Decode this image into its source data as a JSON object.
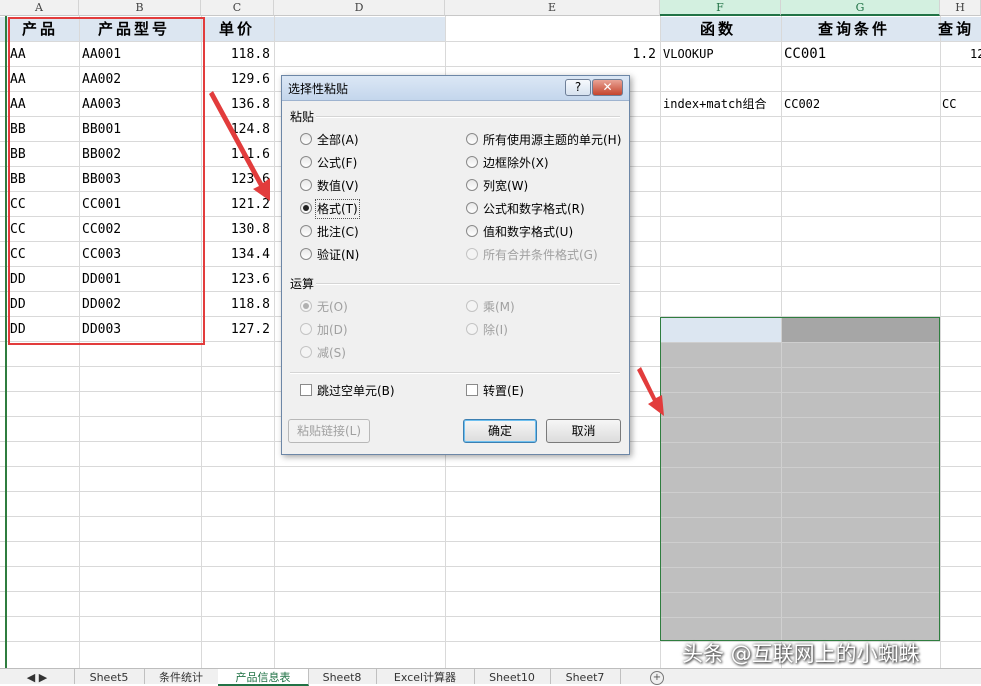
{
  "columns": [
    "A",
    "B",
    "C",
    "D",
    "E",
    "F",
    "G",
    "H"
  ],
  "header_row": {
    "a": "产品",
    "b": "产品型号",
    "c": "单价",
    "f": "函数",
    "g": "查询条件",
    "h": "查询"
  },
  "rows": [
    {
      "a": "AA",
      "b": "AA001",
      "c": "118.8"
    },
    {
      "a": "AA",
      "b": "AA002",
      "c": "129.6"
    },
    {
      "a": "AA",
      "b": "AA003",
      "c": "136.8"
    },
    {
      "a": "BB",
      "b": "BB001",
      "c": "124.8"
    },
    {
      "a": "BB",
      "b": "BB002",
      "c": "111.6"
    },
    {
      "a": "BB",
      "b": "BB003",
      "c": "123.6"
    },
    {
      "a": "CC",
      "b": "CC001",
      "c": "121.2"
    },
    {
      "a": "CC",
      "b": "CC002",
      "c": "130.8"
    },
    {
      "a": "CC",
      "b": "CC003",
      "c": "134.4"
    },
    {
      "a": "DD",
      "b": "DD001",
      "c": "123.6"
    },
    {
      "a": "DD",
      "b": "DD002",
      "c": "118.8"
    },
    {
      "a": "DD",
      "b": "DD003",
      "c": "127.2"
    }
  ],
  "extra": {
    "e2": "1.2",
    "f2": "VLOOKUP",
    "g2": "CC001",
    "h2": "12",
    "f4": "index+match组合",
    "g4": "CC002",
    "h4": "CC"
  },
  "tabs": [
    "Sheet5",
    "条件统计",
    "产品信息表",
    "Sheet8",
    "Excel计算器",
    "Sheet10",
    "Sheet7"
  ],
  "active_tab": "产品信息表",
  "dialog": {
    "title": "选择性粘贴",
    "help": "?",
    "close": "✕",
    "paste_section": "粘贴",
    "paste_left": [
      "全部(A)",
      "公式(F)",
      "数值(V)",
      "格式(T)",
      "批注(C)",
      "验证(N)"
    ],
    "paste_right": [
      "所有使用源主题的单元(H)",
      "边框除外(X)",
      "列宽(W)",
      "公式和数字格式(R)",
      "值和数字格式(U)",
      "所有合并条件格式(G)"
    ],
    "operation_section": "运算",
    "op_left": [
      "无(O)",
      "加(D)",
      "减(S)"
    ],
    "op_right": [
      "乘(M)",
      "除(I)"
    ],
    "skip_blanks": "跳过空单元(B)",
    "transpose": "转置(E)",
    "paste_link": "粘贴链接(L)",
    "ok": "确定",
    "cancel": "取消"
  },
  "watermark": "头条 @互联网上的小蜘蛛",
  "colors": {
    "highlight": "#e23c3c",
    "green": "#217346",
    "header_bg": "#dce6f1",
    "range_gray": "#bfbfbf"
  }
}
